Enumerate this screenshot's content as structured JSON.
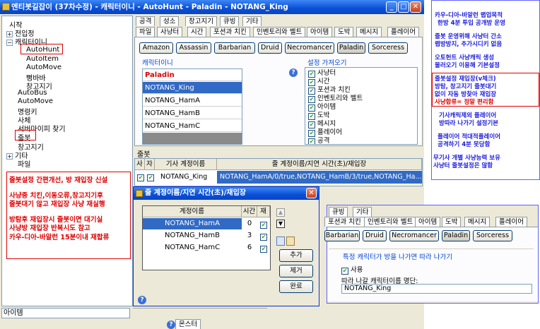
{
  "window": {
    "title": "엔티봇길잡이 (37차수정) - 캐릭터이니 - AutoHunt - Paladin - NOTANG_King",
    "minimize": "_",
    "maximize": "□",
    "close": "✕"
  },
  "tree": {
    "items": [
      {
        "label": "시작",
        "toggle": ""
      },
      {
        "label": "전입정",
        "toggle": "+"
      },
      {
        "label": "캐릭터이니",
        "toggle": "−"
      },
      {
        "label": "AutoHunt",
        "toggle": ""
      },
      {
        "label": "AutoItem",
        "toggle": ""
      },
      {
        "label": "AutoMove",
        "toggle": ""
      },
      {
        "label": "뻥바바",
        "toggle": ""
      },
      {
        "label": "창고지기",
        "toggle": ""
      },
      {
        "label": "AutoBus",
        "toggle": ""
      },
      {
        "label": "AutoMove",
        "toggle": ""
      },
      {
        "label": "명령키",
        "toggle": ""
      },
      {
        "label": "사체",
        "toggle": ""
      },
      {
        "label": "서버마이피 찾기",
        "toggle": ""
      },
      {
        "label": "줄봇",
        "toggle": ""
      },
      {
        "label": "창고지기",
        "toggle": ""
      },
      {
        "label": "기타",
        "toggle": "+"
      },
      {
        "label": "파일",
        "toggle": ""
      }
    ],
    "note_lines": [
      "줄봇설정 간편개선, 방 재입장 신설",
      "사냥중 치킨,이동오류,창고지기후\n줄봇대기 않고 재입장 사냥 재실행",
      "방탐후 재입장시 줄봇이면 대기실\n사냥방 재입장 반복시도 참고\n카우-디아-바알런 15분이내 재합류"
    ]
  },
  "bottom_input": {
    "value": "아이템"
  },
  "tabs_top": [
    "공격",
    "성소",
    "창고지기",
    "큐빙",
    "기타"
  ],
  "tabs_second": [
    "파일",
    "사냥터",
    "시간",
    "포션과 치킨",
    "인벤토리와 벨트",
    "아이템",
    "도박",
    "메시지",
    "플레이어"
  ],
  "classes": [
    "Amazon",
    "Assassin",
    "Barbarian",
    "Druid",
    "Necromancer",
    "Paladin",
    "Sorceress"
  ],
  "selected_class": "Paladin",
  "characters_group": {
    "label": "캐릭터이니",
    "header": "Paladin",
    "rows": [
      "NOTANG_King",
      "NOTANG_HamA",
      "NOTANG_HamB",
      "NOTANG_HamC"
    ],
    "selected": "NOTANG_King"
  },
  "settings_group": {
    "label": "설정 가져오기",
    "help": "?",
    "items": [
      "사냥터",
      "시간",
      "포션과 치킨",
      "인벤토리와 벨트",
      "아이템",
      "도박",
      "메시지",
      "플레이어",
      "공격"
    ]
  },
  "jul_section": {
    "label": "줄봇",
    "columns": [
      "사",
      "자",
      "기사 계정이름",
      "줄 계정이름/지연 시간(초)/재입장"
    ],
    "row": {
      "name": "NOTANG_King",
      "value": "NOTANG_HamA/0/true,NOTANG_HamB/3/true,NOTANG_Ha..."
    }
  },
  "dialog": {
    "title": "줄 계정이름/지연 시간(초)/재입장",
    "close": "✕",
    "columns": [
      "계정이름",
      "시간",
      "재"
    ],
    "rows": [
      {
        "name": "NOTANG_HamA",
        "time": "0"
      },
      {
        "name": "NOTANG_HamB",
        "time": "3"
      },
      {
        "name": "NOTANG_HamC",
        "time": "6"
      }
    ],
    "add": "추가",
    "remove": "제거",
    "done": "완료",
    "help": "?"
  },
  "bottom_tab": {
    "help": "?",
    "label": "몬스터"
  },
  "right_note": [
    {
      "text": "카우-디아-바알런 랩업목적",
      "red": false
    },
    {
      "text": "한방 4분 투입 공개방 운영",
      "red": false
    },
    {
      "text": "줄봇 운영위해 사냥터 간소",
      "red": false
    },
    {
      "text": "랩방방지, 추가시디키 없음",
      "red": false
    },
    {
      "text": "오토헌트 사냥캐릭 생성",
      "red": false
    },
    {
      "text": "물러오기 이용해 기본설정",
      "red": false
    },
    {
      "text": "줄봇설정 재입장(v체크)",
      "red": true
    },
    {
      "text": "방탐, 창고지기 줄봇대기",
      "red": true
    },
    {
      "text": "없이 자동 방찾아 재입장",
      "red": true
    },
    {
      "text": "사냥합류= 정말 편리함",
      "red": true
    },
    {
      "text": "기사캐릭제외 플레이어",
      "red": false
    },
    {
      "text": "방따라 나가기 설정기본",
      "red": false
    },
    {
      "text": "플레이어 적대적플레이어",
      "red": false
    },
    {
      "text": "공격하기 4분 못당함",
      "red": false
    },
    {
      "text": "무기사 개별 사냥능력 보유",
      "red": false
    },
    {
      "text": "사냥터 줄봇설정은 않함",
      "red": false
    }
  ],
  "shot2": {
    "tabs_top": [
      "큐빙",
      "기타"
    ],
    "tabs_second": [
      "포션과 치킨",
      "인벤토리와 벨트",
      "아이템",
      "도박",
      "메시지",
      "플레이어"
    ],
    "classes": [
      "Barbarian",
      "Druid",
      "Necromancer",
      "Paladin",
      "Sorceress"
    ],
    "follow_label": "특정 캐릭터가 방을 나가면 따라 나가기",
    "use_label": "사용",
    "target_label": "따라 나갈 캐릭터이름 명단:",
    "target_value": "NOTANG_King"
  }
}
